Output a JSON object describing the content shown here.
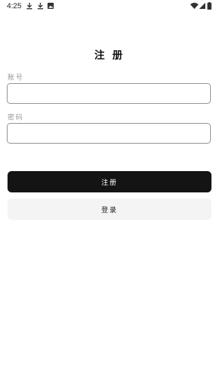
{
  "status_bar": {
    "time": "4:25",
    "left_icons": [
      "download-icon",
      "download-icon",
      "image-notification-icon"
    ],
    "right_icons": [
      "wifi-icon",
      "cell-signal-icon",
      "battery-icon"
    ]
  },
  "page": {
    "title": "注 册"
  },
  "form": {
    "account_label": "账号",
    "account_value": "",
    "account_placeholder": "",
    "password_label": "密码",
    "password_value": "",
    "password_placeholder": ""
  },
  "actions": {
    "register_label": "注册",
    "login_label": "登录"
  },
  "colors": {
    "primary_button": "#141414",
    "secondary_button": "#f4f4f4",
    "label_text": "#9a9a9a",
    "border": "#8a8a8a"
  }
}
